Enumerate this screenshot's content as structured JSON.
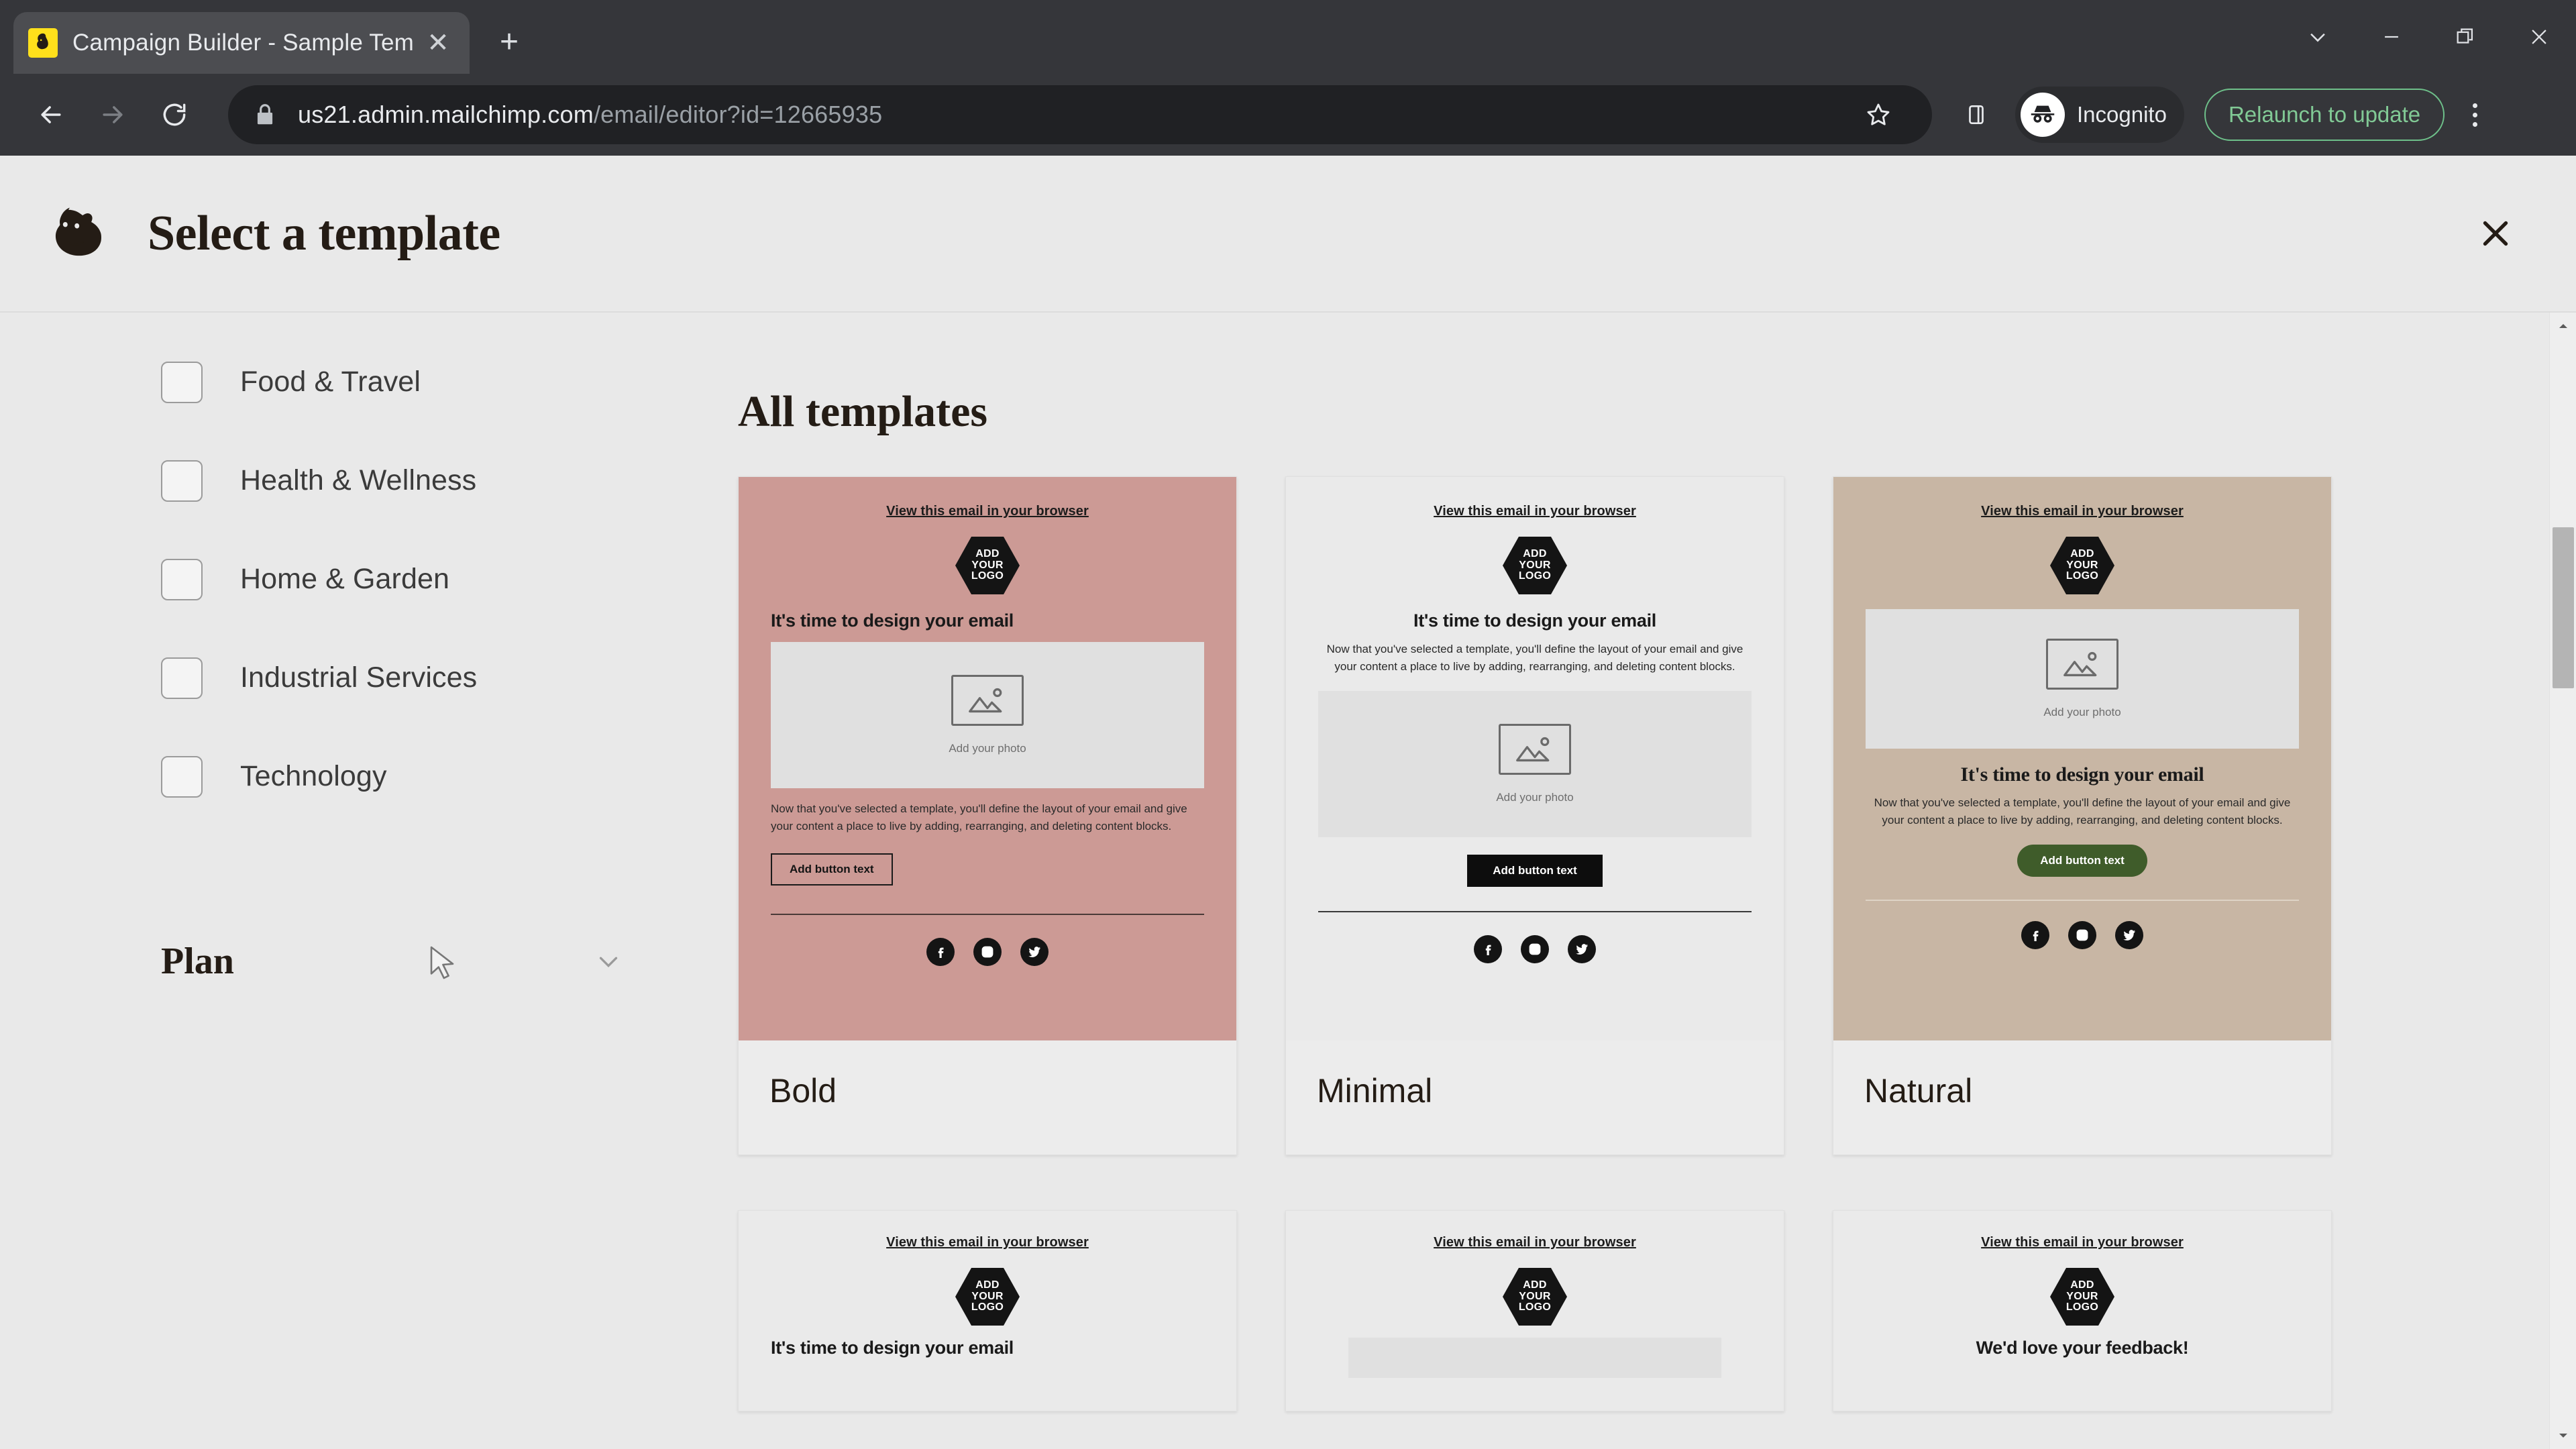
{
  "browser": {
    "tab": {
      "title": "Campaign Builder - Sample Tem",
      "favicon_icon": "mailchimp-favicon",
      "close_icon": "close-icon"
    },
    "new_tab_icon": "plus-icon",
    "window": {
      "minimize_icon": "minimize-icon",
      "maximize_icon": "maximize-icon",
      "close_icon": "close-icon",
      "tab_search_icon": "chevron-down-icon"
    },
    "nav": {
      "back_icon": "back-arrow-icon",
      "forward_icon": "forward-arrow-icon",
      "reload_icon": "reload-icon"
    },
    "omnibox": {
      "lock_icon": "lock-icon",
      "url_domain": "us21.admin.mailchimp.com",
      "url_path": "/email/editor?id=12665935",
      "bookmark_icon": "star-icon"
    },
    "side_panel_icon": "side-panel-icon",
    "profile": {
      "label": "Incognito",
      "icon": "incognito-icon"
    },
    "update_button": {
      "label": "Relaunch to update",
      "accent": "#81c995"
    },
    "menu_icon": "three-dots-icon"
  },
  "modal": {
    "logo_icon": "mailchimp-freddie-logo",
    "title": "Select a template",
    "close_icon": "close-icon"
  },
  "sidebar": {
    "filters": [
      {
        "label": "Food & Travel",
        "checked": false
      },
      {
        "label": "Health & Wellness",
        "checked": false
      },
      {
        "label": "Home & Garden",
        "checked": false
      },
      {
        "label": "Industrial Services",
        "checked": false
      },
      {
        "label": "Technology",
        "checked": false
      }
    ],
    "section": {
      "title": "Plan",
      "chevron_icon": "chevron-down-icon"
    }
  },
  "main": {
    "heading": "All templates",
    "email_common": {
      "view_link": "View this email in your browser",
      "logo_line1": "ADD",
      "logo_line2": "YOUR",
      "logo_line3": "LOGO",
      "headline": "It's time to design your email",
      "body": "Now that you've selected a template, you'll define the layout of your email and give your content a place to live by adding, rearranging, and deleting content blocks.",
      "photo_caption": "Add your photo",
      "button_label": "Add button text",
      "photo_icon": "image-placeholder-icon",
      "social_icons": [
        "facebook-icon",
        "instagram-icon",
        "twitter-icon"
      ]
    },
    "templates": [
      {
        "name": "Bold",
        "bg": "#cc9a95",
        "button_style": "outline"
      },
      {
        "name": "Minimal",
        "bg": "#eaeaea",
        "button_style": "solid"
      },
      {
        "name": "Natural",
        "bg": "#c8b6a4",
        "button_style": "pill",
        "button_color": "#3f5c2a"
      }
    ],
    "templates_row2": [
      {
        "headline": "It's time to design your email"
      },
      {
        "headline": ""
      },
      {
        "headline": "We'd love your feedback!"
      }
    ]
  },
  "scrollbar": {
    "up_icon": "scroll-up-arrow",
    "down_icon": "scroll-down-arrow"
  },
  "cursor": {
    "icon": "mouse-pointer"
  }
}
